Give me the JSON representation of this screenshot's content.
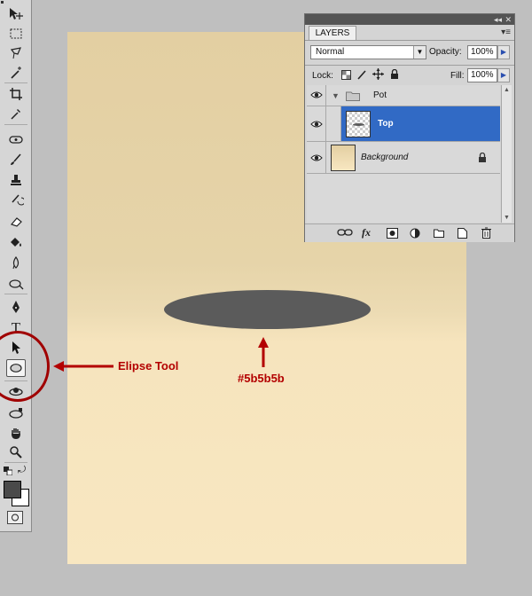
{
  "tools_panel": {
    "tools": [
      "move-tool-icon",
      "marquee-tool-icon",
      "lasso-tool-icon",
      "magic-wand-tool-icon",
      "crop-tool-icon",
      "eyedropper-tool-icon",
      "spot-healing-tool-icon",
      "brush-tool-icon",
      "clone-stamp-tool-icon",
      "history-brush-tool-icon",
      "eraser-tool-icon",
      "paint-bucket-tool-icon",
      "blur-tool-icon",
      "dodge-tool-icon",
      "pen-tool-icon",
      "type-tool-icon",
      "path-selection-tool-icon",
      "ellipse-tool-icon",
      "3d-rotate-tool-icon",
      "3d-orbit-tool-icon",
      "hand-tool-icon",
      "zoom-tool-icon"
    ],
    "selected_tool": "ellipse-tool-icon",
    "type_glyph": "T",
    "foreground_color": "#4a4a4a",
    "background_color": "#ffffff"
  },
  "canvas": {
    "ellipse_color": "#5b5b5b"
  },
  "annotations": {
    "tool_label": "Elipse Tool",
    "color_label": "#5b5b5b",
    "color": "#b30000"
  },
  "layers_panel": {
    "tab_label": "LAYERS",
    "collapse_glyph": "◂◂",
    "close_glyph": "✕",
    "menu_glyph": "▾≡",
    "blend_mode": "Normal",
    "opacity_label": "Opacity:",
    "opacity_value": "100%",
    "lock_label": "Lock:",
    "fill_label": "Fill:",
    "fill_value": "100%",
    "layers": [
      {
        "name": "Pot",
        "type": "group",
        "visible": true
      },
      {
        "name": "Top",
        "type": "layer",
        "visible": true,
        "selected": true
      },
      {
        "name": "Background",
        "type": "background",
        "visible": true,
        "locked": true
      }
    ],
    "bottom_icons": [
      "link-layers-icon",
      "fx-icon",
      "add-mask-icon",
      "adjustment-layer-icon",
      "new-group-icon",
      "new-layer-icon",
      "delete-layer-icon"
    ],
    "fx_glyph": "fx",
    "selection_color": "#316ac5"
  }
}
